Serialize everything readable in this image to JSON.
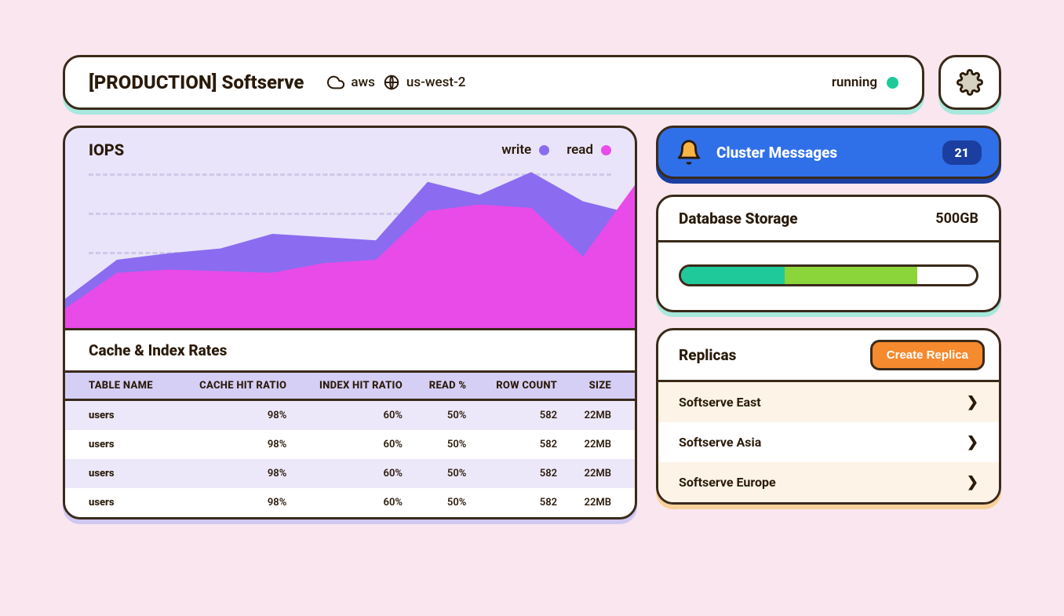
{
  "header": {
    "title": "[PRODUCTION] Softserve",
    "provider": "aws",
    "region": "us-west-2",
    "status_label": "running",
    "status_color": "#1fc99a"
  },
  "iops": {
    "title": "IOPS",
    "legend_write": "write",
    "legend_read": "read"
  },
  "chart_data": {
    "type": "area",
    "title": "IOPS",
    "xlabel": "",
    "ylabel": "",
    "ylim": [
      0,
      100
    ],
    "x": [
      0,
      1,
      2,
      3,
      4,
      5,
      6,
      7,
      8,
      9,
      10,
      11
    ],
    "series": [
      {
        "name": "write",
        "color": "#8b6cf0",
        "values": [
          18,
          42,
          46,
          49,
          58,
          56,
          54,
          90,
          82,
          96,
          78,
          70
        ]
      },
      {
        "name": "read",
        "color": "#e84be8",
        "values": [
          12,
          34,
          36,
          35,
          34,
          40,
          42,
          72,
          76,
          74,
          44,
          88
        ]
      }
    ]
  },
  "rates": {
    "title": "Cache & Index Rates",
    "columns": [
      "TABLE NAME",
      "CACHE HIT RATIO",
      "INDEX HIT RATIO",
      "READ %",
      "ROW COUNT",
      "SIZE"
    ],
    "rows": [
      {
        "table": "users",
        "cache": "98%",
        "index": "60%",
        "read": "50%",
        "rows": "582",
        "size": "22MB"
      },
      {
        "table": "users",
        "cache": "98%",
        "index": "60%",
        "read": "50%",
        "rows": "582",
        "size": "22MB"
      },
      {
        "table": "users",
        "cache": "98%",
        "index": "60%",
        "read": "50%",
        "rows": "582",
        "size": "22MB"
      },
      {
        "table": "users",
        "cache": "98%",
        "index": "60%",
        "read": "50%",
        "rows": "582",
        "size": "22MB"
      }
    ]
  },
  "messages": {
    "title": "Cluster Messages",
    "count": "21"
  },
  "storage": {
    "title": "Database Storage",
    "value": "500GB"
  },
  "replicas": {
    "title": "Replicas",
    "create_label": "Create Replica",
    "items": [
      {
        "name": "Softserve East"
      },
      {
        "name": "Softserve Asia"
      },
      {
        "name": "Softserve Europe"
      }
    ]
  }
}
